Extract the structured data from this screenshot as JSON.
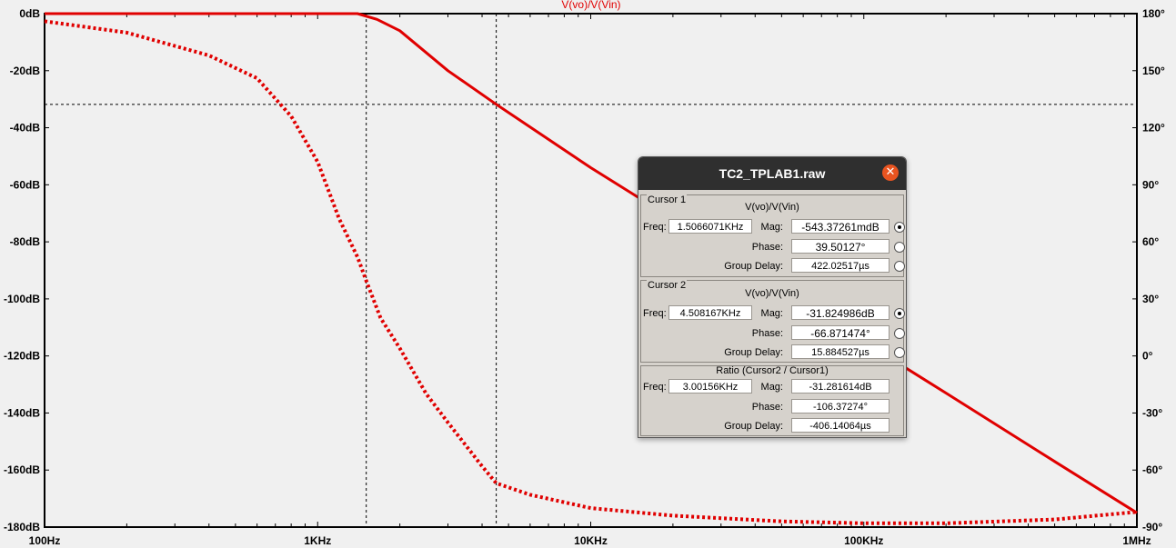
{
  "chart_data": {
    "type": "line",
    "title": "V(vo)/V(Vin)",
    "x_scale": "log",
    "x_range_hz": [
      100,
      1000000
    ],
    "x_tick_labels": [
      "100Hz",
      "1KHz",
      "10KHz",
      "100KHz",
      "1MHz"
    ],
    "y_left_range_db": [
      -180,
      0
    ],
    "y_left_tick_labels": [
      "0dB",
      "-20dB",
      "-40dB",
      "-60dB",
      "-80dB",
      "-100dB",
      "-120dB",
      "-140dB",
      "-160dB",
      "-180dB"
    ],
    "y_right_range_deg": [
      -90,
      180
    ],
    "y_right_tick_labels": [
      "180°",
      "150°",
      "120°",
      "90°",
      "60°",
      "30°",
      "0°",
      "-30°",
      "-60°",
      "-90°"
    ],
    "series": [
      {
        "line_style": "solid",
        "axis": "left",
        "x_hz": [
          100,
          500,
          1000,
          1400,
          1650,
          2000,
          3000,
          4508,
          10000,
          20000,
          50000,
          100000,
          200000,
          500000,
          1000000
        ],
        "y_db": [
          0,
          0,
          0,
          0,
          -2,
          -6,
          -20,
          -31.8,
          -54,
          -72,
          -96,
          -115,
          -133,
          -157,
          -175
        ]
      },
      {
        "line_style": "dotted",
        "axis": "right",
        "x_hz": [
          100,
          200,
          400,
          600,
          800,
          1000,
          1200,
          1400,
          1506.6,
          1700,
          2000,
          2500,
          3000,
          4000,
          4508,
          6000,
          10000,
          20000,
          50000,
          100000,
          200000,
          500000,
          1000000
        ],
        "y_deg": [
          176,
          170,
          158,
          146,
          126,
          102,
          72,
          52,
          39.5,
          20,
          4,
          -20,
          -35,
          -58,
          -66.9,
          -73,
          -80,
          -84,
          -87,
          -88,
          -88,
          -86,
          -82
        ]
      }
    ],
    "grid": false,
    "color": "#e00000"
  },
  "cursors": {
    "cursor1_freq_hz": 1506.6071,
    "cursor2_freq_hz": 4508.167,
    "cursor2_mag_db": -31.824986
  },
  "dialog": {
    "title": "TC2_TPLAB1.raw",
    "close_icon": "close-icon",
    "cursor1": {
      "label": "Cursor 1",
      "signal": "V(vo)/V(Vin)",
      "freq_label": "Freq:",
      "freq": "1.5066071KHz",
      "mag_label": "Mag:",
      "mag": "-543.37261mdB",
      "phase_label": "Phase:",
      "phase": "39.50127°",
      "group_delay_label": "Group Delay:",
      "group_delay": "422.02517µs"
    },
    "cursor2": {
      "label": "Cursor 2",
      "signal": "V(vo)/V(Vin)",
      "freq_label": "Freq:",
      "freq": "4.508167KHz",
      "mag_label": "Mag:",
      "mag": "-31.824986dB",
      "phase_label": "Phase:",
      "phase": "-66.871474°",
      "group_delay_label": "Group Delay:",
      "group_delay": "15.884527µs"
    },
    "ratio": {
      "label": "Ratio (Cursor2 / Cursor1)",
      "freq_label": "Freq:",
      "freq": "3.00156KHz",
      "mag_label": "Mag:",
      "mag": "-31.281614dB",
      "phase_label": "Phase:",
      "phase": "-106.37274°",
      "group_delay_label": "Group Delay:",
      "group_delay": "-406.14064µs"
    }
  }
}
